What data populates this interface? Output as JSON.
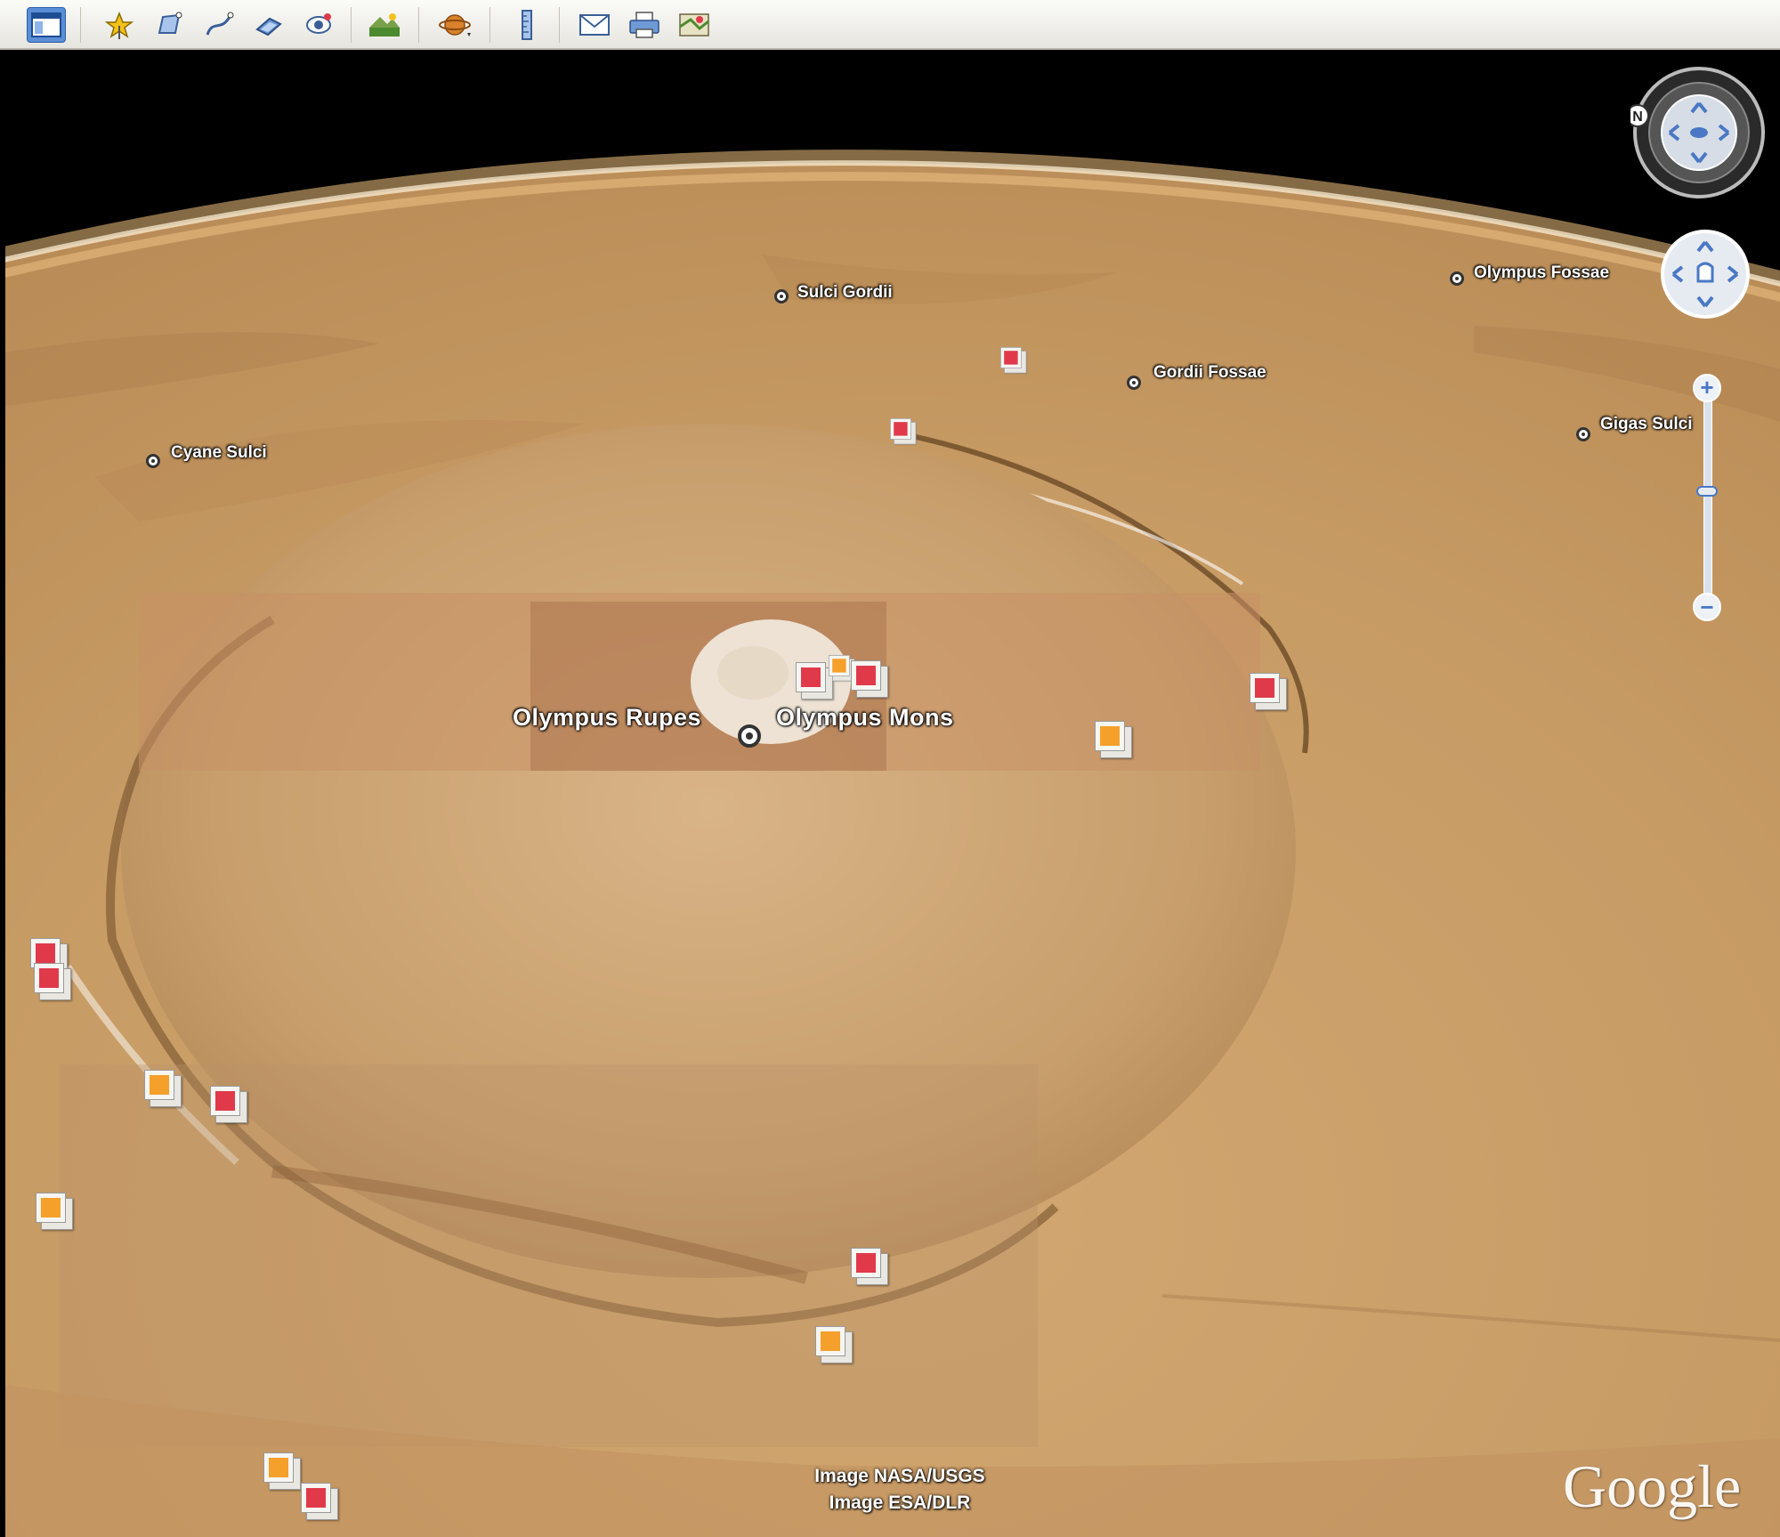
{
  "toolbar": {
    "buttons": [
      {
        "name": "sidebar",
        "icon": "sidebar-icon",
        "active": true
      },
      {
        "name": "add-placemark",
        "icon": "placemark-icon"
      },
      {
        "name": "add-polygon",
        "icon": "polygon-icon"
      },
      {
        "name": "add-path",
        "icon": "path-icon"
      },
      {
        "name": "image-overlay",
        "icon": "image-overlay-icon"
      },
      {
        "name": "record-tour",
        "icon": "record-tour-icon"
      },
      {
        "name": "historical-imagery",
        "icon": "historical-imagery-icon"
      },
      {
        "name": "sunlight",
        "icon": "sunlight-icon"
      },
      {
        "name": "planet-switch",
        "icon": "planet-icon"
      },
      {
        "name": "ruler",
        "icon": "ruler-icon"
      },
      {
        "name": "email",
        "icon": "email-icon"
      },
      {
        "name": "print",
        "icon": "print-icon"
      },
      {
        "name": "view-in-maps",
        "icon": "maps-icon"
      }
    ]
  },
  "map": {
    "labels": {
      "olympus_rupes": "Olympus Rupes",
      "olympus_mons": "Olympus Mons",
      "cyane_sulci": "Cyane Sulci",
      "gordii_fossae": "Gordii Fossae",
      "gigas_sulci": "Gigas Sulci",
      "sulci_gordii": "Sulci Gordii",
      "olympus_fossae": "Olympus Fossae"
    },
    "credits": {
      "line1": "Image NASA/USGS",
      "line2": "Image ESA/DLR"
    },
    "brand": "Google",
    "colors": {
      "surface": "#c89a62",
      "red_marker": "#e03a4a",
      "orange_marker": "#f5a02a"
    }
  },
  "controls": {
    "zoom_in": "+",
    "zoom_out": "−",
    "north_label": "N"
  }
}
